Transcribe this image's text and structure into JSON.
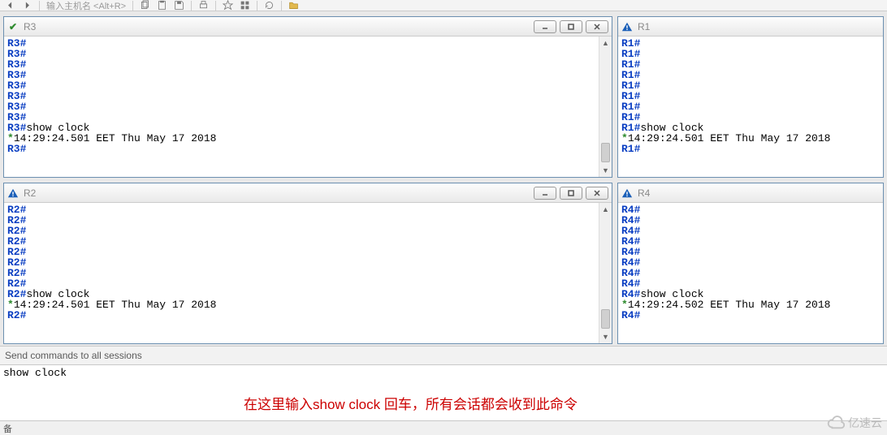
{
  "toolbar": {
    "hint": "输入主机名 <Alt+R>"
  },
  "panes": {
    "r3": {
      "title": "R3",
      "status": "ok",
      "lines": [
        {
          "p": "R3#"
        },
        {
          "p": "R3#"
        },
        {
          "p": "R3#"
        },
        {
          "p": "R3#"
        },
        {
          "p": "R3#"
        },
        {
          "p": "R3#"
        },
        {
          "p": "R3#"
        },
        {
          "p": "R3#"
        },
        {
          "p": "R3#",
          "t": "show clock"
        },
        {
          "star": "*",
          "t": "14:29:24.501 EET Thu May 17 2018"
        },
        {
          "p": "R3#"
        }
      ]
    },
    "r1": {
      "title": "R1",
      "status": "warn",
      "lines": [
        {
          "p": "R1#"
        },
        {
          "p": "R1#"
        },
        {
          "p": "R1#"
        },
        {
          "p": "R1#"
        },
        {
          "p": "R1#"
        },
        {
          "p": "R1#"
        },
        {
          "p": "R1#"
        },
        {
          "p": "R1#"
        },
        {
          "p": "R1#",
          "t": "show clock"
        },
        {
          "star": "*",
          "t": "14:29:24.501 EET Thu May 17 2018"
        },
        {
          "p": "R1#"
        }
      ]
    },
    "r2": {
      "title": "R2",
      "status": "warn",
      "lines": [
        {
          "p": "R2#"
        },
        {
          "p": "R2#"
        },
        {
          "p": "R2#"
        },
        {
          "p": "R2#"
        },
        {
          "p": "R2#"
        },
        {
          "p": "R2#"
        },
        {
          "p": "R2#"
        },
        {
          "p": "R2#"
        },
        {
          "p": "R2#",
          "t": "show clock"
        },
        {
          "star": "*",
          "t": "14:29:24.501 EET Thu May 17 2018"
        },
        {
          "p": "R2#"
        }
      ]
    },
    "r4": {
      "title": "R4",
      "status": "warn",
      "lines": [
        {
          "p": "R4#"
        },
        {
          "p": "R4#"
        },
        {
          "p": "R4#"
        },
        {
          "p": "R4#"
        },
        {
          "p": "R4#"
        },
        {
          "p": "R4#"
        },
        {
          "p": "R4#"
        },
        {
          "p": "R4#"
        },
        {
          "p": "R4#",
          "t": "show clock"
        },
        {
          "star": "*",
          "t": "14:29:24.502 EET Thu May 17 2018"
        },
        {
          "p": "R4#"
        }
      ]
    }
  },
  "send": {
    "label": "Send commands to all sessions",
    "value": "show clock",
    "annotation": "在这里输入show clock 回车，所有会话都会收到此命令"
  },
  "statusbar": "备",
  "watermark": "亿速云"
}
